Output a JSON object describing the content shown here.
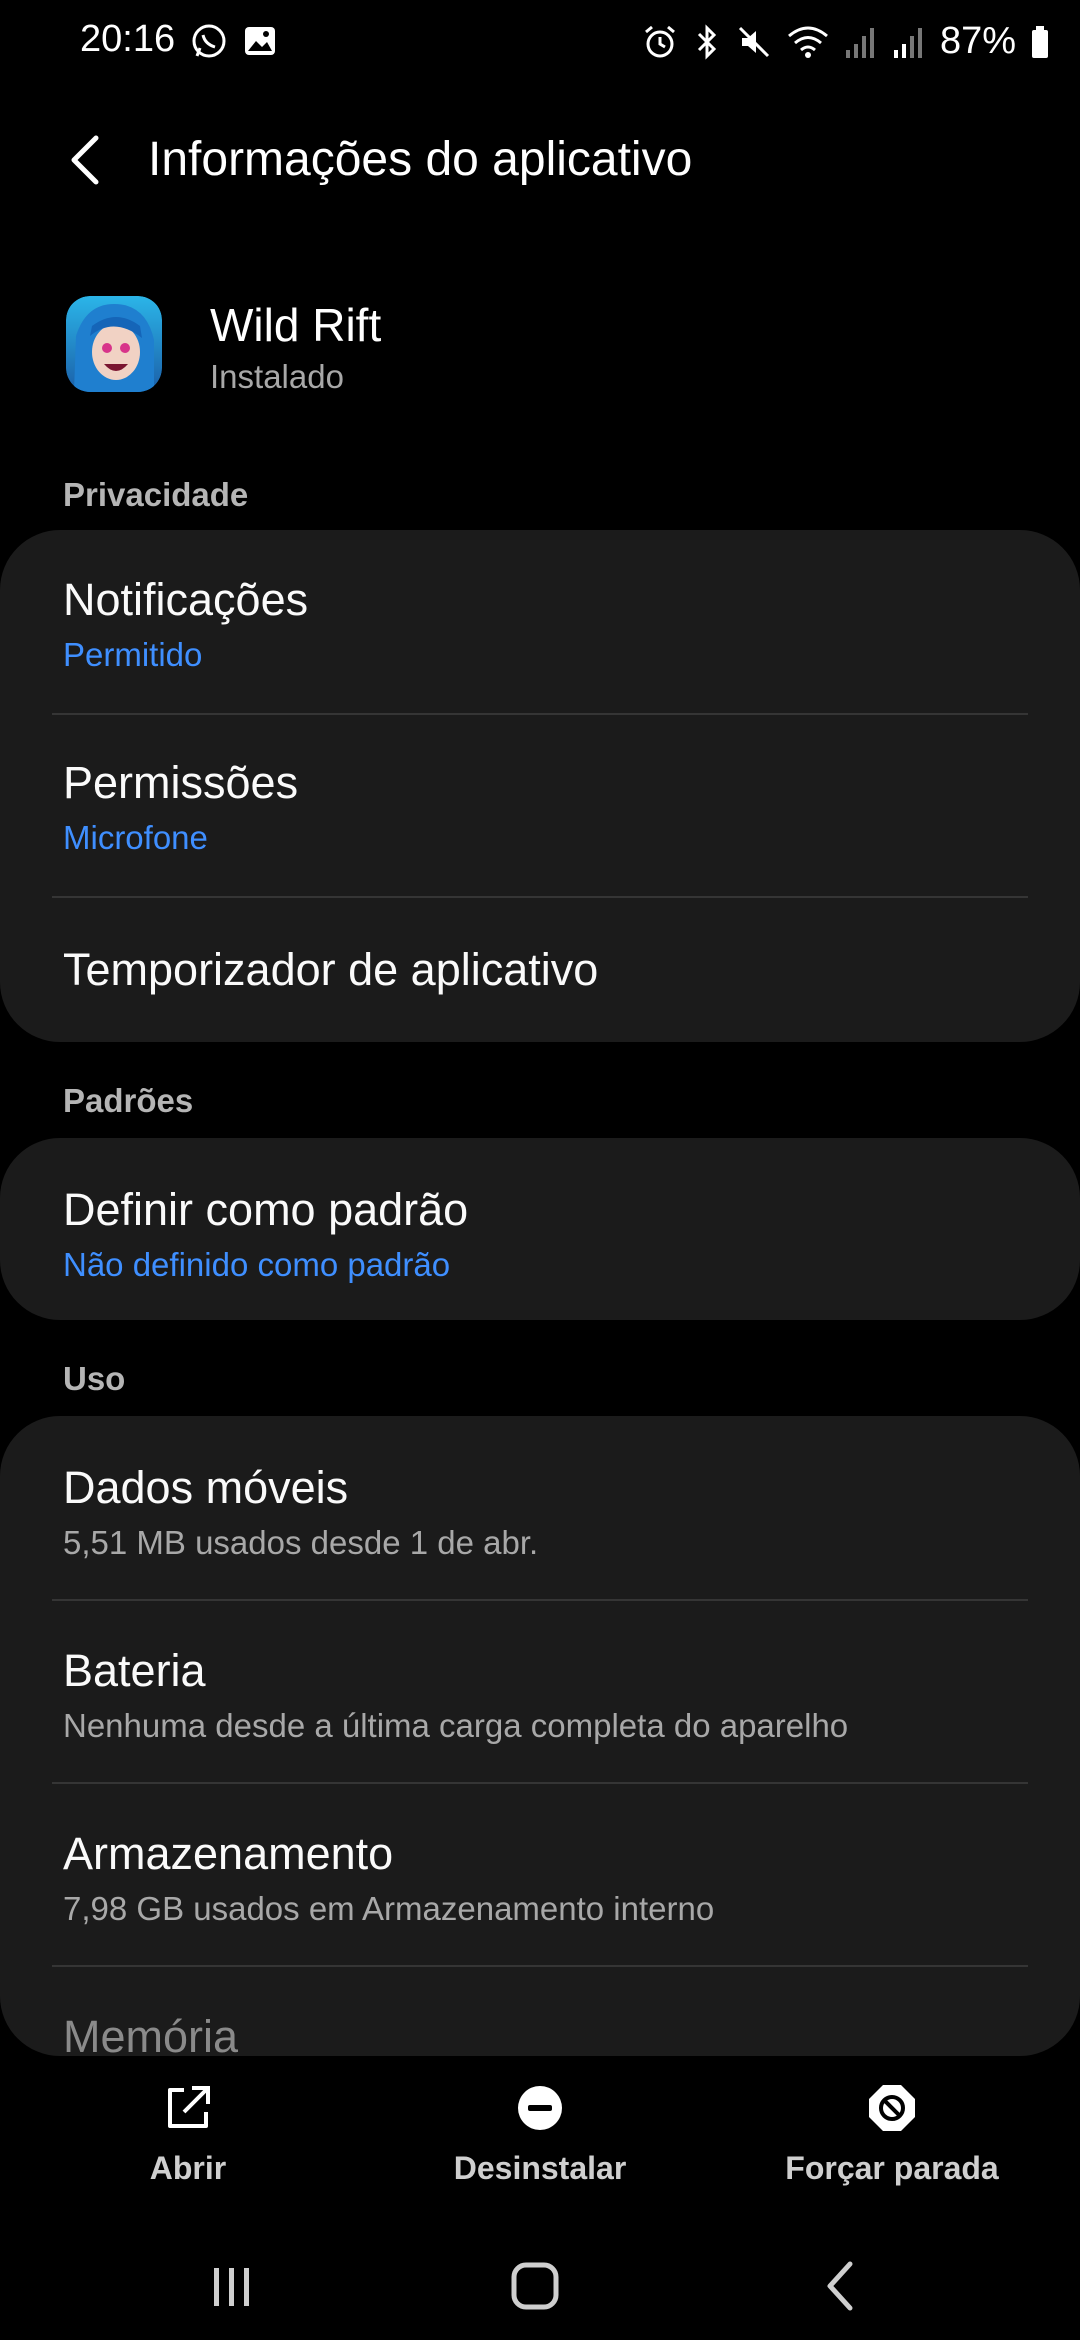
{
  "status_bar": {
    "time": "20:16",
    "battery_text": "87%"
  },
  "header": {
    "title": "Informações do aplicativo"
  },
  "app": {
    "name": "Wild Rift",
    "status": "Instalado"
  },
  "sections": {
    "privacy": {
      "label": "Privacidade",
      "items": [
        {
          "title": "Notificações",
          "subtitle": "Permitido"
        },
        {
          "title": "Permissões",
          "subtitle": "Microfone"
        },
        {
          "title": "Temporizador de aplicativo"
        }
      ]
    },
    "defaults": {
      "label": "Padrões",
      "items": [
        {
          "title": "Definir como padrão",
          "subtitle": "Não definido como padrão"
        }
      ]
    },
    "usage": {
      "label": "Uso",
      "items": [
        {
          "title": "Dados móveis",
          "subtitle": "5,51 MB usados desde 1 de abr."
        },
        {
          "title": "Bateria",
          "subtitle": "Nenhuma desde a última carga completa do aparelho"
        },
        {
          "title": "Armazenamento",
          "subtitle": "7,98 GB usados em Armazenamento interno"
        },
        {
          "title": "Memória"
        }
      ]
    }
  },
  "actions": {
    "open": "Abrir",
    "uninstall": "Desinstalar",
    "force_stop": "Forçar parada"
  },
  "colors": {
    "background": "#000000",
    "card": "#1b1b1b",
    "accent_blue": "#3f8fff",
    "secondary_text": "#a8a8a8"
  }
}
